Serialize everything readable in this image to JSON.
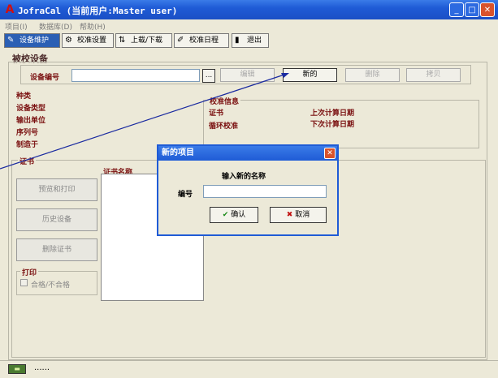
{
  "window": {
    "title": "JofraCal (当前用户:Master user)",
    "minimize": "_",
    "maximize": "□",
    "close": "✕"
  },
  "menu": [
    {
      "label": "项目(I)"
    },
    {
      "label": "数据库(D)"
    },
    {
      "label": "帮助(H)"
    }
  ],
  "toolbar": {
    "device_maintenance": "设备维护",
    "calibration_settings": "校准设置",
    "upload_download": "上载/下载",
    "calibration_schedule": "校准日程",
    "exit": "退出"
  },
  "main": {
    "section_title": "被校设备",
    "device_number_label": "设备编号",
    "device_number_value": "",
    "browse_label": "...",
    "edit_label": "编辑",
    "new_label": "新的",
    "delete_label": "删除",
    "copy_label": "拷贝",
    "fields": {
      "category": "种类",
      "device_type": "设备类型",
      "output_unit": "输出单位",
      "serial_number": "序列号",
      "manufacturer": "制造于"
    },
    "calibration_info": {
      "title": "校准信息",
      "certificate": "证书",
      "cycle_calibration": "循环校准",
      "last_calc_date": "上次计算日期",
      "next_calc_date": "下次计算日期"
    },
    "certificate": {
      "title": "证书",
      "preview_print": "预览和打印",
      "history_device": "历史设备",
      "delete_certificate": "删除证书",
      "name_column": "证书名称",
      "print_group": "打印",
      "pass_fail_label": "合格/不合格"
    }
  },
  "dialog": {
    "title": "新的项目",
    "prompt": "输入新的名称",
    "number_label": "编号",
    "number_value": "",
    "ok_label": "确认",
    "cancel_label": "取消",
    "close": "✕"
  },
  "status_bar": {
    "text": "......"
  },
  "colors": {
    "title_blue": "#1f5bd6",
    "label_red": "#7a1010",
    "face": "#ece9d8"
  }
}
